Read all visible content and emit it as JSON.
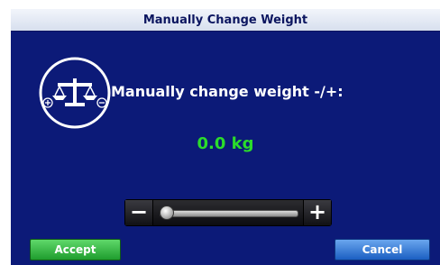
{
  "window": {
    "title": "Manually Change Weight"
  },
  "main": {
    "prompt": "Manually change weight -/+:",
    "weight_value": "0.0 kg"
  },
  "slider": {
    "minus_label": "−",
    "plus_label": "+",
    "level_fraction": 0.0
  },
  "buttons": {
    "accept_label": "Accept",
    "cancel_label": "Cancel"
  },
  "icons": {
    "scale": "balance-scale-icon",
    "plus": "plus-circle-icon",
    "minus": "minus-circle-icon"
  },
  "colors": {
    "background": "#0c1a78",
    "weight_text": "#2bdc2b",
    "accept": "#2ea83a",
    "cancel": "#2a6fd0"
  }
}
